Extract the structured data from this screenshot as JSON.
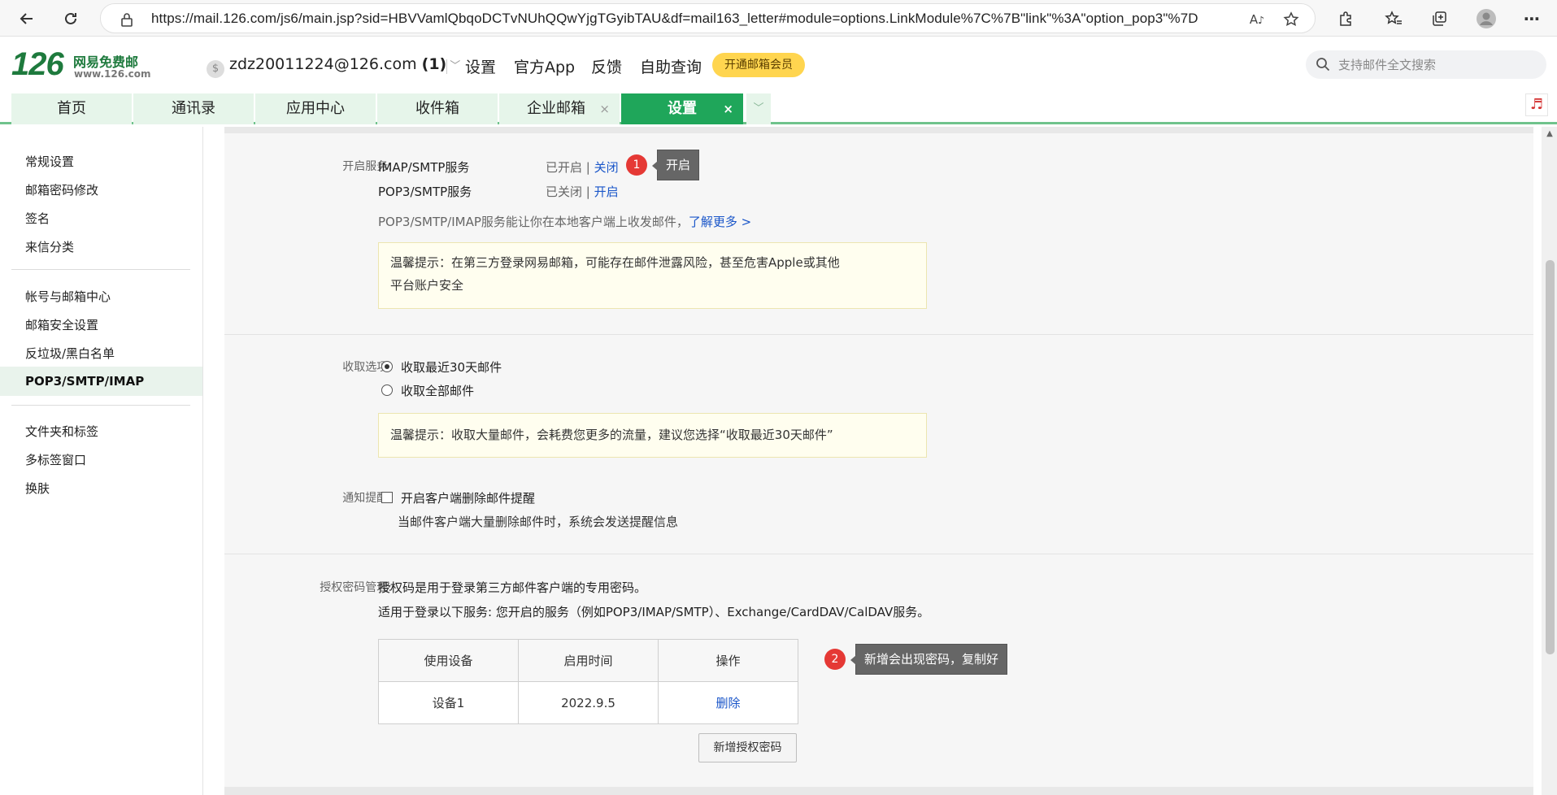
{
  "browser": {
    "url": "https://mail.126.com/js6/main.jsp?sid=HBVVamlQbqoDCTvNUhQQwYjgTGyibTAU&df=mail163_letter#module=options.LinkModule%7C%7B\"link\"%3A\"option_pop3\"%7D"
  },
  "header": {
    "logo_number": "126",
    "logo_name": "网易免费邮",
    "logo_domain": "www.126.com",
    "account": "zdz20011224@126.com",
    "account_count": "(1)",
    "links": [
      "设置",
      "官方App",
      "反馈",
      "自助查询"
    ],
    "vip_label": "开通邮箱会员",
    "search_placeholder": "支持邮件全文搜索"
  },
  "tabs": [
    {
      "label": "首页"
    },
    {
      "label": "通讯录"
    },
    {
      "label": "应用中心"
    },
    {
      "label": "收件箱"
    },
    {
      "label": "企业邮箱"
    },
    {
      "label": "设置",
      "active": true
    }
  ],
  "sidebar": {
    "group1": [
      "常规设置",
      "邮箱密码修改",
      "签名",
      "来信分类"
    ],
    "group2": [
      "帐号与邮箱中心",
      "邮箱安全设置",
      "反垃圾/黑白名单",
      "POP3/SMTP/IMAP"
    ],
    "group3": [
      "文件夹和标签",
      "多标签窗口",
      "换肤"
    ],
    "active": "POP3/SMTP/IMAP"
  },
  "services": {
    "label": "开启服务:",
    "imap_name": "IMAP/SMTP服务",
    "imap_status": "已开启",
    "imap_action": "关闭",
    "pop3_name": "POP3/SMTP服务",
    "pop3_status": "已关闭",
    "pop3_action": "开启",
    "separator": "|",
    "desc": "POP3/SMTP/IMAP服务能让你在本地客户端上收发邮件，",
    "learn_more": "了解更多 >",
    "tip_line1": "温馨提示：在第三方登录网易邮箱，可能存在邮件泄露风险，甚至危害Apple或其他",
    "tip_line2": "平台账户安全"
  },
  "receive": {
    "label": "收取选项:",
    "option1": "收取最近30天邮件",
    "option2": "收取全部邮件",
    "selected": "收取最近30天邮件",
    "tip": "温馨提示：收取大量邮件，会耗费您更多的流量，建议您选择“收取最近30天邮件”"
  },
  "notify": {
    "label": "通知提醒:",
    "checkbox_label": "开启客户端删除邮件提醒",
    "checked": false,
    "desc": "当邮件客户端大量删除邮件时，系统会发送提醒信息"
  },
  "auth": {
    "label": "授权密码管理:",
    "desc1": "授权码是用于登录第三方邮件客户端的专用密码。",
    "desc2": "适用于登录以下服务: 您开启的服务（例如POP3/IMAP/SMTP）、Exchange/CardDAV/CalDAV服务。",
    "columns": [
      "使用设备",
      "启用时间",
      "操作"
    ],
    "rows": [
      {
        "device": "设备1",
        "time": "2022.9.5",
        "action": "删除"
      }
    ],
    "add_button": "新增授权密码"
  },
  "annotations": {
    "marker1": "1",
    "callout1": "开启",
    "marker2": "2",
    "callout2": "新增会出现密码，复制好"
  }
}
